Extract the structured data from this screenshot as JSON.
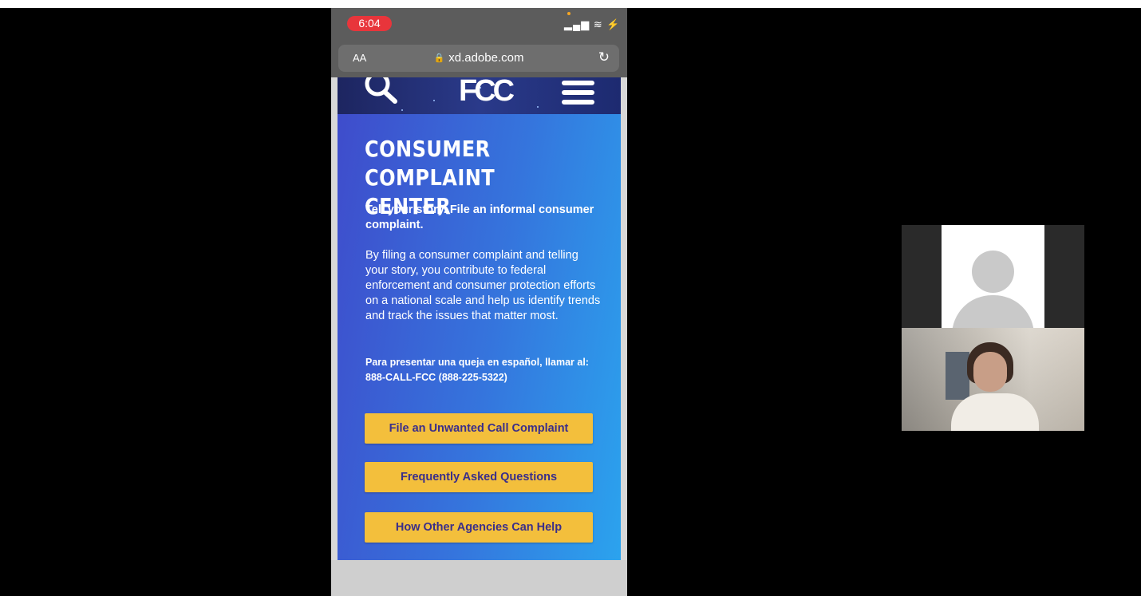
{
  "phone": {
    "status_time": "6:04",
    "status_icons": "▂▄▆ ≋ ⚡",
    "browser": {
      "text_size_label": "AA",
      "url": "xd.adobe.com",
      "lock_icon": "🔒",
      "reload_icon": "↻"
    },
    "site": {
      "logo_text": "FCC",
      "heading": "CONSUMER COMPLAINT CENTER",
      "tagline": "Tell your story. File an informal consumer complaint.",
      "body": "By filing a consumer complaint and telling your story, you contribute to federal enforcement and consumer protection efforts on a national scale and help us identify trends and track the issues that matter most.",
      "spanish_line1": "Para presentar una queja en español, llamar al:",
      "spanish_line2": "888-CALL-FCC (888-225-5322)",
      "buttons": [
        {
          "label": "File an Unwanted Call Complaint"
        },
        {
          "label": "Frequently Asked Questions"
        },
        {
          "label": "How Other Agencies Can Help"
        }
      ]
    }
  },
  "colors": {
    "cta_background": "#f3bf3c",
    "cta_text": "#3a2e8a",
    "recording_pill": "#e8353b"
  }
}
